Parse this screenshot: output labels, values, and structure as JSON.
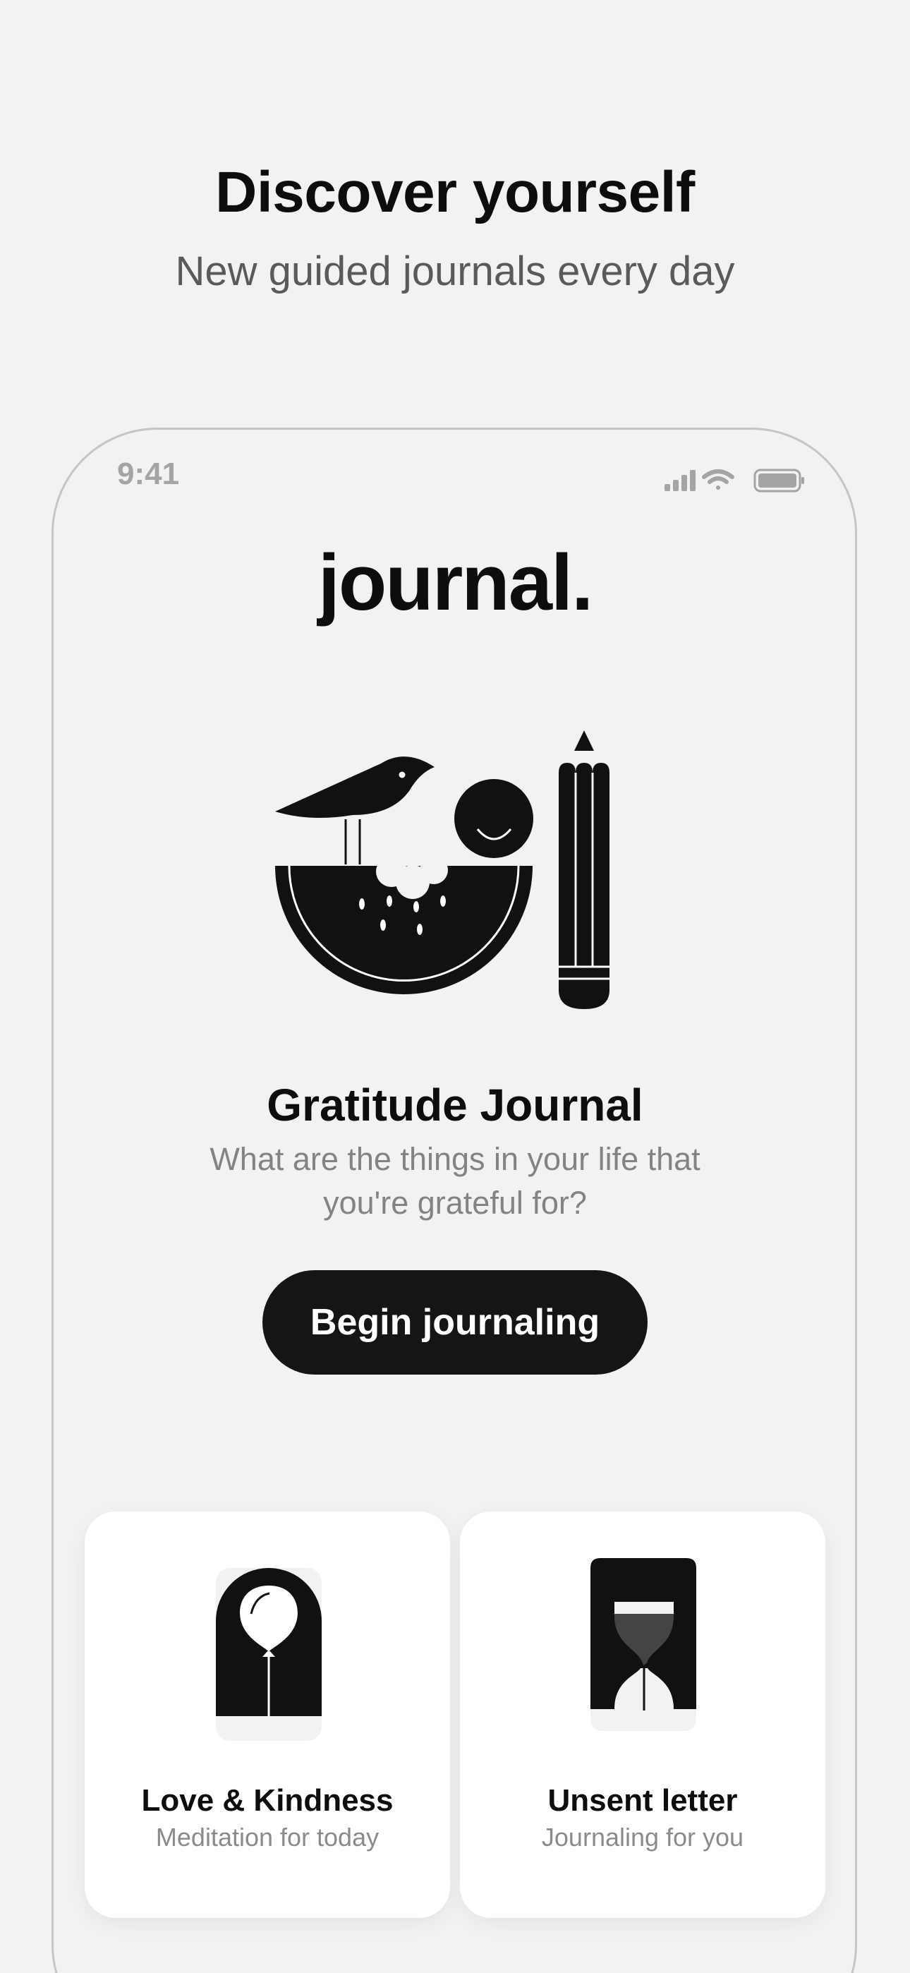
{
  "header": {
    "title": "Discover yourself",
    "subtitle": "New guided journals every day"
  },
  "status_bar": {
    "time": "9:41"
  },
  "app": {
    "logo": "journal."
  },
  "featured": {
    "illustration": "bird-watermelon-pencil-illustration",
    "title": "Gratitude Journal",
    "description": "What are the things in your life that you're grateful for?",
    "button_label": "Begin journaling"
  },
  "cards": [
    {
      "icon": "balloon-icon",
      "title": "Love & Kindness",
      "subtitle": "Meditation for today"
    },
    {
      "icon": "hourglass-icon",
      "title": "Unsent letter",
      "subtitle": "Journaling for you"
    }
  ],
  "colors": {
    "background": "#f1f2f4",
    "text_primary": "#0d0d0d",
    "text_secondary": "#828385",
    "button": "#151515",
    "card": "#ffffff"
  }
}
